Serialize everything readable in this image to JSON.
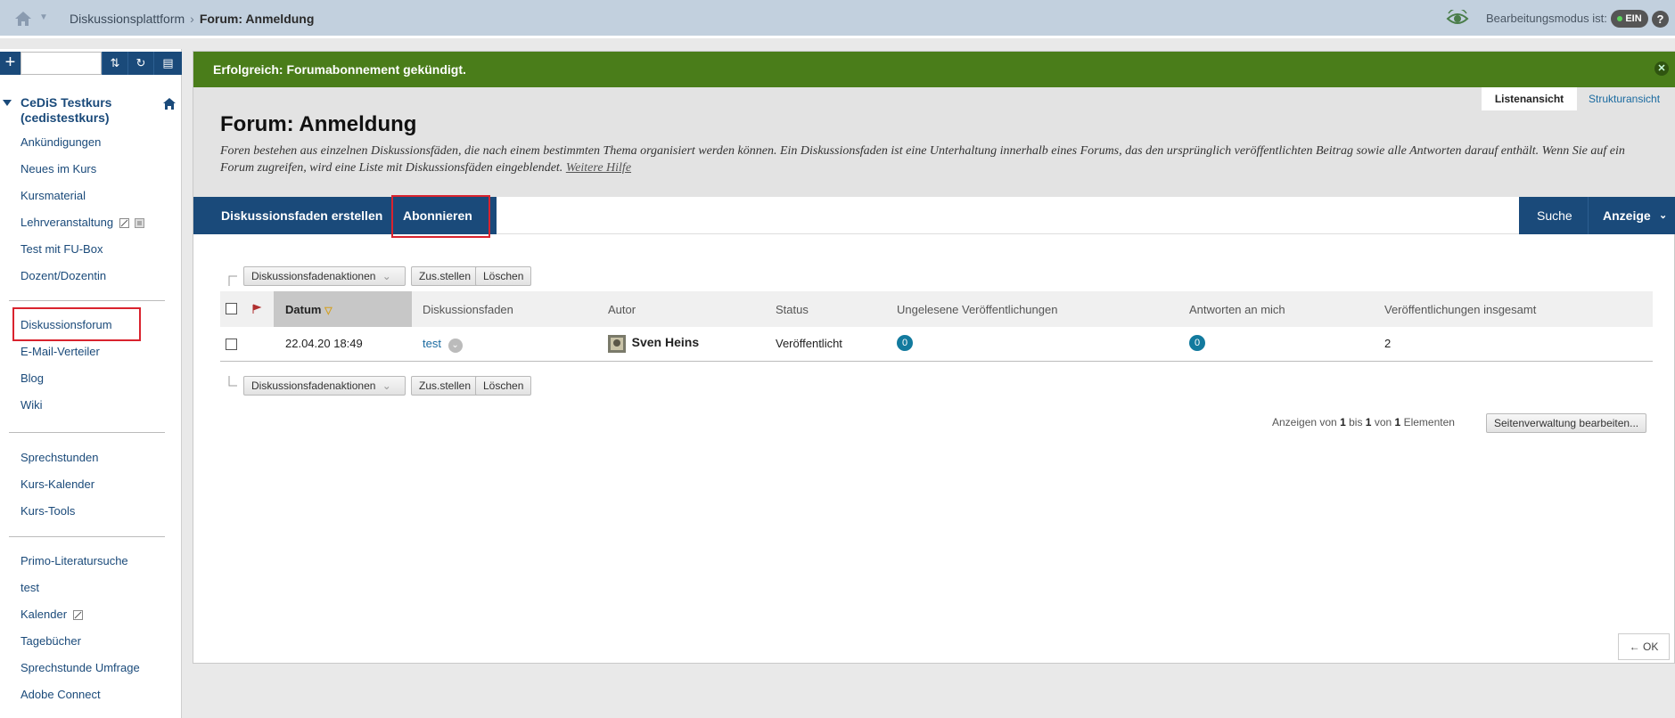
{
  "topbar": {
    "breadcrumb": [
      "Diskussionsplattform",
      "Forum: Anmeldung"
    ],
    "edit_mode_label": "Bearbeitungsmodus ist:",
    "edit_mode_value": "EIN",
    "help": "?"
  },
  "sidebar": {
    "course_title": "CeDiS Testkurs (cedistestkurs)",
    "group1": [
      "Ankündigungen",
      "Neues im Kurs",
      "Kursmaterial",
      "Lehrveranstaltung",
      "Test mit FU-Box",
      "Dozent/Dozentin"
    ],
    "group2": [
      "Diskussionsforum",
      "E-Mail-Verteiler",
      "Blog",
      "Wiki"
    ],
    "group3": [
      "Sprechstunden",
      "Kurs-Kalender",
      "Kurs-Tools"
    ],
    "group4": [
      "Primo-Literatursuche",
      "test",
      "Kalender",
      "Tagebücher",
      "Sprechstunde Umfrage",
      "Adobe Connect"
    ]
  },
  "main": {
    "success_message": "Erfolgreich: Forumabonnement gekündigt.",
    "view_list": "Listenansicht",
    "view_tree": "Strukturansicht",
    "title": "Forum: Anmeldung",
    "description": "Foren bestehen aus einzelnen Diskussionsfäden, die nach einem bestimmten Thema organisiert werden können. Ein Diskussionsfaden ist eine Unterhaltung innerhalb eines Forums, das den ursprünglich veröffentlichten Beitrag sowie alle Antworten darauf enthält. Wenn Sie auf ein Forum zugreifen, wird eine Liste mit Diskussionsfäden eingeblendet.",
    "more_help": "Weitere Hilfe",
    "actions": {
      "create_thread": "Diskussionsfaden erstellen",
      "subscribe": "Abonnieren",
      "search": "Suche",
      "display": "Anzeige"
    },
    "toolbar": {
      "thread_actions": "Diskussionsfadenaktionen",
      "compose": "Zus.stellen",
      "delete": "Löschen"
    },
    "table": {
      "headers": {
        "date": "Datum",
        "thread": "Diskussionsfaden",
        "author": "Autor",
        "status": "Status",
        "unread": "Ungelesene Veröffentlichungen",
        "replies_to_me": "Antworten an mich",
        "total": "Veröffentlichungen insgesamt"
      },
      "rows": [
        {
          "date": "22.04.20 18:49",
          "thread": "test",
          "author": "Sven Heins",
          "status": "Veröffentlicht",
          "unread": "0",
          "replies_to_me": "0",
          "total": "2"
        }
      ]
    },
    "paging": {
      "prefix": "Anzeigen von",
      "from": "1",
      "to_label": "bis",
      "to": "1",
      "of_label": "von",
      "total": "1",
      "suffix": "Elementen",
      "edit_button": "Seitenverwaltung bearbeiten..."
    },
    "ok_button": "← OK"
  }
}
